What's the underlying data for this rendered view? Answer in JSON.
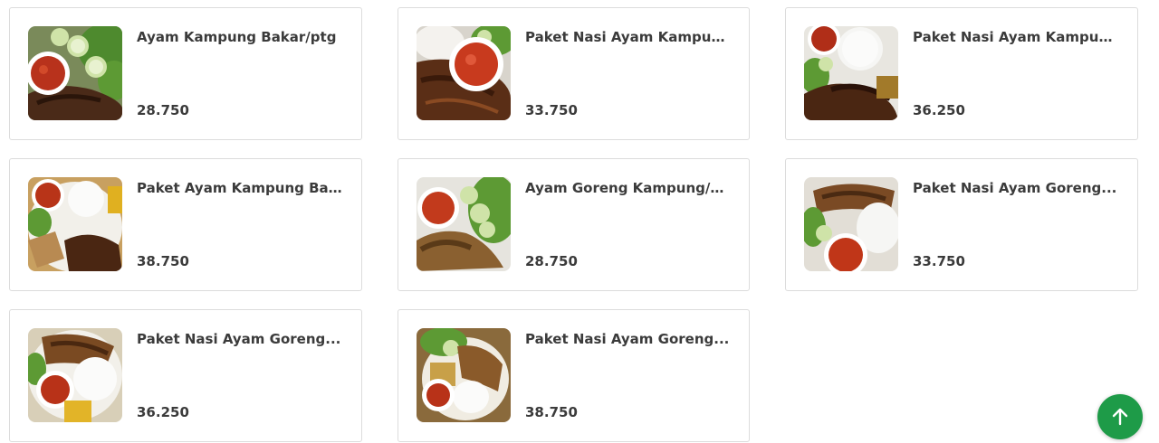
{
  "menu_items": [
    {
      "name": "Ayam Kampung Bakar/ptg",
      "price": "28.750",
      "image": "grilled-chicken-sambal-cucumber"
    },
    {
      "name": "Paket Nasi Ayam Kampung...",
      "price": "33.750",
      "image": "grilled-chicken-sambal-rice"
    },
    {
      "name": "Paket Nasi Ayam Kampung...",
      "price": "36.250",
      "image": "grilled-chicken-rice-plate"
    },
    {
      "name": "Paket Ayam Kampung Bakar...",
      "price": "38.750",
      "image": "grilled-chicken-rice-tofu-tempeh"
    },
    {
      "name": "Ayam Goreng Kampung/ptg",
      "price": "28.750",
      "image": "fried-chicken-sambal-cucumber"
    },
    {
      "name": "Paket Nasi Ayam Goreng...",
      "price": "33.750",
      "image": "fried-chicken-rice-sambal"
    },
    {
      "name": "Paket Nasi Ayam Goreng...",
      "price": "36.250",
      "image": "fried-chicken-rice-plate"
    },
    {
      "name": "Paket Nasi Ayam Goreng...",
      "price": "38.750",
      "image": "fried-chicken-rice-tofu-tempeh"
    }
  ],
  "scroll_top_button": {
    "icon": "arrow-up-icon",
    "color": "#1e9b48"
  }
}
